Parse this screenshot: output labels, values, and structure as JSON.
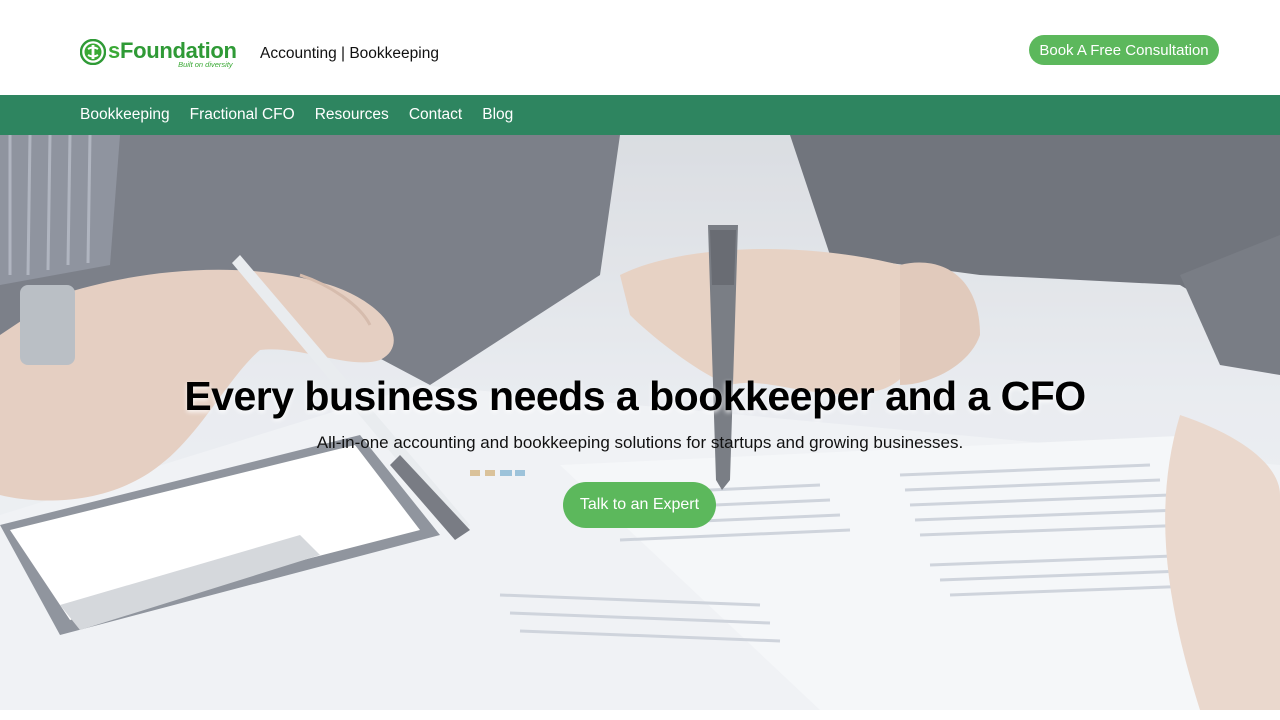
{
  "brand": {
    "logo_first": "s",
    "logo_rest": "Foundation",
    "logo_tagline": "Built on diversity",
    "tagline": "Accounting | Bookkeeping",
    "colors": {
      "primary_green": "#5cb85c",
      "nav_green": "#2e8560",
      "logo_green": "#3aa935"
    }
  },
  "header": {
    "cta_label": "Book A Free Consultation"
  },
  "nav": {
    "items": [
      {
        "label": "Bookkeeping"
      },
      {
        "label": "Fractional CFO"
      },
      {
        "label": "Resources"
      },
      {
        "label": "Contact"
      },
      {
        "label": "Blog"
      }
    ]
  },
  "hero": {
    "background_image": "business-people-reviewing-financial-reports",
    "title": "Every business needs a bookkeeper and a CFO",
    "subtitle": "All-in-one accounting and bookkeeping solutions for startups and growing businesses.",
    "cta_label": "Talk to an Expert"
  }
}
